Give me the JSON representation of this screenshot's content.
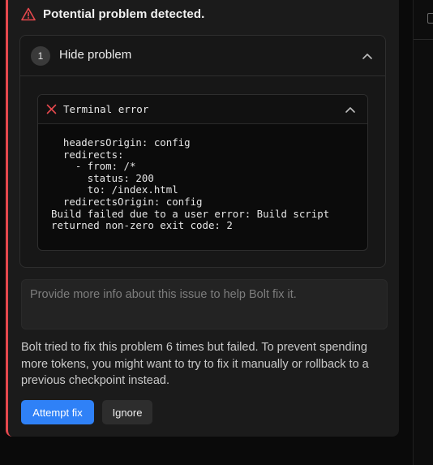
{
  "colors": {
    "accent": "#2f81f7",
    "error": "#e5484d",
    "panel_bg": "#1b1b1b"
  },
  "alert": {
    "icon": "warning-triangle-icon",
    "title": "Potential problem detected."
  },
  "problem": {
    "step_number": "1",
    "label": "Hide problem",
    "toggle_icon": "chevron-up-icon"
  },
  "terminal": {
    "icon": "close-x-icon",
    "title": "Terminal error",
    "toggle_icon": "chevron-up-icon",
    "output": "  headersOrigin: config\n  redirects:\n    - from: /*\n      status: 200\n      to: /index.html\n  redirectsOrigin: config\nBuild failed due to a user error: Build script\nreturned non-zero exit code: 2"
  },
  "feedback": {
    "placeholder": "Provide more info about this issue to help Bolt fix it.",
    "value": ""
  },
  "message": "Bolt tried to fix this problem 6 times but failed. To prevent spending more tokens, you might want to try to fix it manually or rollback to a previous checkpoint instead.",
  "actions": {
    "attempt_fix_label": "Attempt fix",
    "ignore_label": "Ignore"
  }
}
